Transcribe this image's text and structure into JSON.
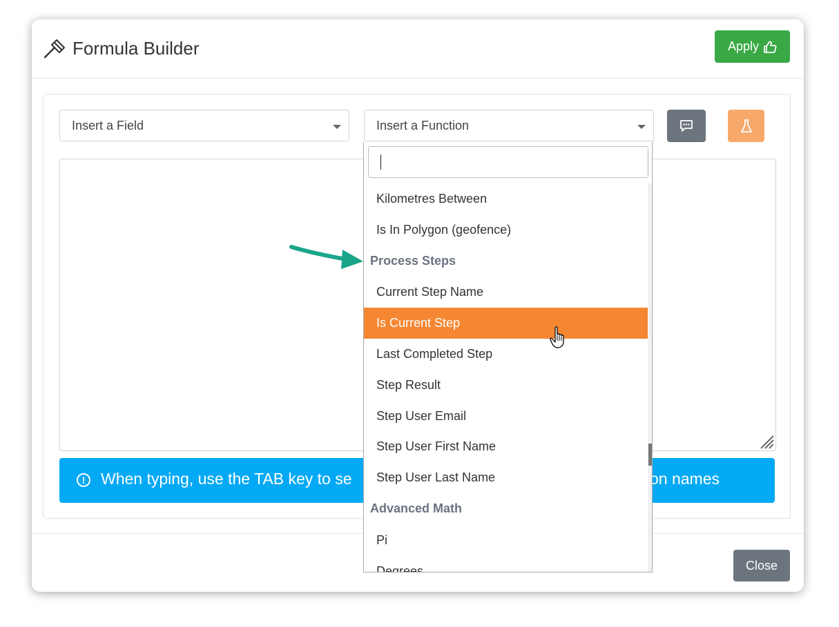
{
  "modal": {
    "title": "Formula Builder",
    "apply_label": "Apply",
    "close_label": "Close"
  },
  "field_select": {
    "placeholder": "Insert a Field"
  },
  "function_select": {
    "placeholder": "Insert a Function",
    "search_value": "",
    "items": [
      {
        "label": "Kilometres Between",
        "type": "option"
      },
      {
        "label": "Is In Polygon (geofence)",
        "type": "option"
      },
      {
        "label": "Process Steps",
        "type": "group"
      },
      {
        "label": "Current Step Name",
        "type": "option"
      },
      {
        "label": "Is Current Step",
        "type": "option",
        "highlighted": true
      },
      {
        "label": "Last Completed Step",
        "type": "option"
      },
      {
        "label": "Step Result",
        "type": "option"
      },
      {
        "label": "Step User Email",
        "type": "option"
      },
      {
        "label": "Step User First Name",
        "type": "option"
      },
      {
        "label": "Step User Last Name",
        "type": "option"
      },
      {
        "label": "Advanced Math",
        "type": "group"
      },
      {
        "label": "Pi",
        "type": "option"
      },
      {
        "label": "Degrees",
        "type": "option"
      }
    ]
  },
  "info_alert": {
    "text_left": "When typing, use the TAB key to se",
    "text_right": "on names"
  },
  "icons": {
    "title": "hammer-icon",
    "apply": "thumbs-up-icon",
    "comment_button": "comment-dots-icon",
    "test_button": "flask-icon",
    "info": "exclamation-circle-icon"
  },
  "colors": {
    "apply": "#3aa945",
    "info_alert": "#03a9f4",
    "highlight": "#f58733",
    "test_button": "#f7a96b",
    "secondary_button": "#6c757d",
    "annotation_arrow": "#1aa58a"
  }
}
